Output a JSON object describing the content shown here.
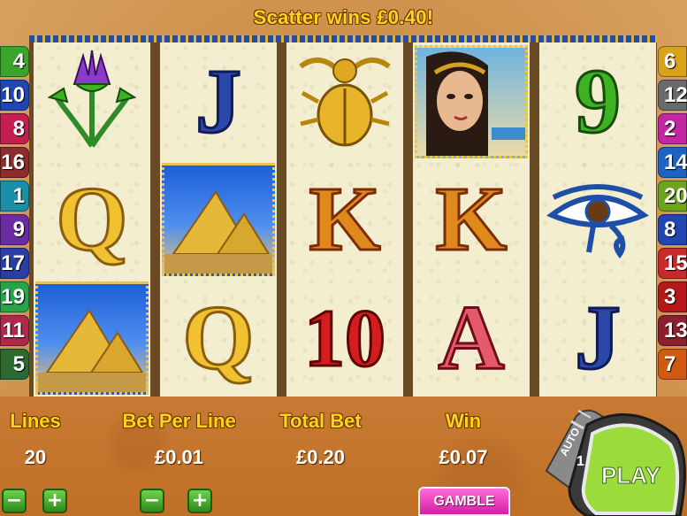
{
  "banner": {
    "message": "Scatter wins £0.40!"
  },
  "left_lines": [
    "4",
    "10",
    "8",
    "16",
    "1",
    "9",
    "17",
    "19",
    "11",
    "5"
  ],
  "right_lines": [
    "6",
    "12",
    "2",
    "14",
    "20",
    "8",
    "15",
    "3",
    "13",
    "7"
  ],
  "line_colors": [
    "#3aa52a",
    "#2146b3",
    "#c41f4f",
    "#8e2b2b",
    "#1a8fa5",
    "#6a2ba3",
    "#2a3ea8",
    "#28a34a",
    "#b0284a",
    "#2b6a2e"
  ],
  "reels": [
    [
      {
        "symbol": "lotus",
        "icon": "lotus-icon"
      },
      {
        "symbol": "Q",
        "icon": "queen-q-icon"
      },
      {
        "symbol": "pyramids",
        "icon": "pyramids-icon"
      }
    ],
    [
      {
        "symbol": "J",
        "icon": "jack-j-icon"
      },
      {
        "symbol": "pyramids",
        "icon": "pyramids-icon"
      },
      {
        "symbol": "Q",
        "icon": "queen-q-icon"
      }
    ],
    [
      {
        "symbol": "scarab",
        "icon": "scarab-icon"
      },
      {
        "symbol": "K",
        "icon": "king-k-icon"
      },
      {
        "symbol": "10",
        "icon": "ten-icon"
      }
    ],
    [
      {
        "symbol": "cleopatra",
        "icon": "cleopatra-icon"
      },
      {
        "symbol": "K",
        "icon": "king-k-icon"
      },
      {
        "symbol": "A",
        "icon": "ace-a-icon"
      }
    ],
    [
      {
        "symbol": "9",
        "icon": "nine-icon"
      },
      {
        "symbol": "eye",
        "icon": "eye-of-horus-icon"
      },
      {
        "symbol": "J",
        "icon": "jack-j-icon"
      }
    ]
  ],
  "controls": {
    "lines_label": "Lines",
    "lines_value": "20",
    "bet_per_line_label": "Bet Per Line",
    "bet_per_line_value": "£0.01",
    "total_bet_label": "Total Bet",
    "total_bet_value": "£0.20",
    "win_label": "Win",
    "win_value": "£0.07",
    "minus": "−",
    "plus": "+",
    "gamble_label": "GAMBLE",
    "auto_label": "AUTO",
    "auto_value": "1",
    "play_label": "PLAY"
  }
}
